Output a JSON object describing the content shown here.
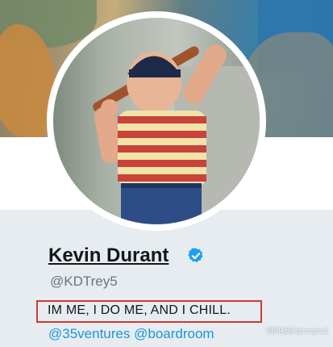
{
  "profile": {
    "name": "Kevin Durant",
    "handle": "@KDTrey5",
    "bio": "IM ME, I DO ME, AND I CHILL.",
    "links": [
      "@35ventures",
      "@boardroom"
    ],
    "verified_icon": "verified-badge-icon"
  },
  "watermark": "何问社区@ninghu1",
  "colors": {
    "verified": "#1da1f2",
    "link": "#1b95e0",
    "highlight_box": "#d23a2f",
    "background": "#e6ecf0"
  }
}
